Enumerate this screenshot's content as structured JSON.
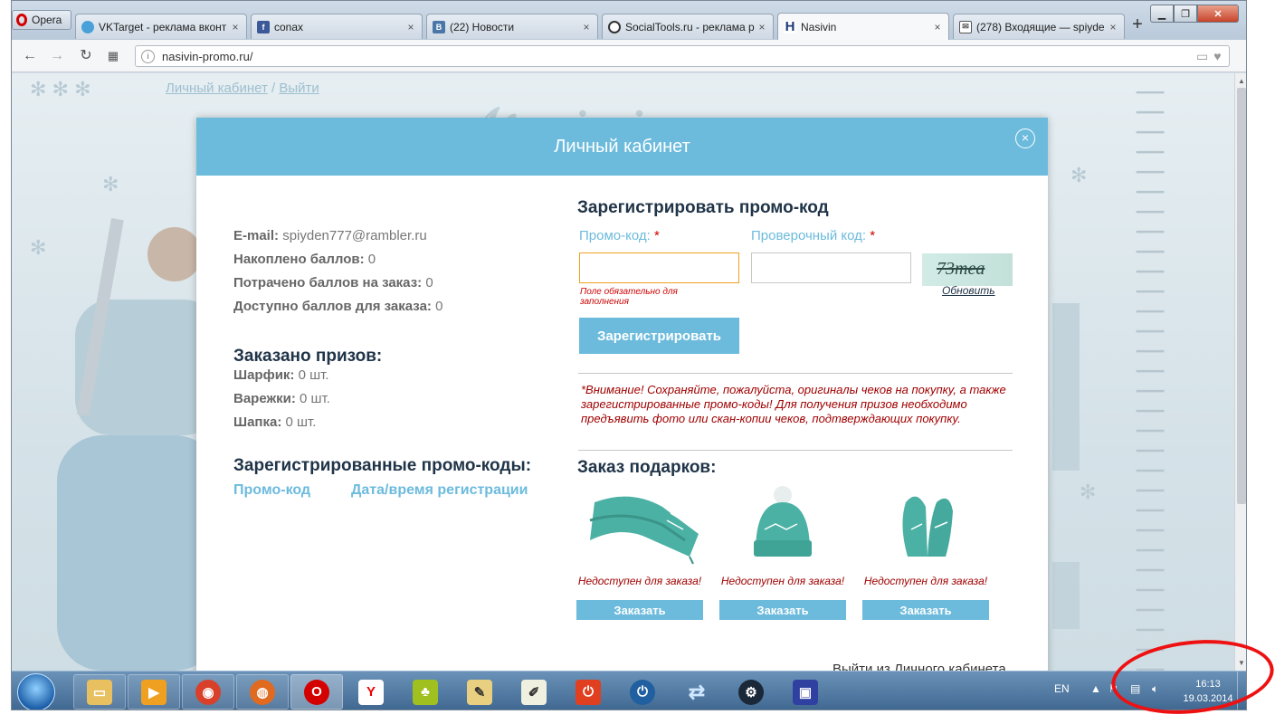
{
  "browser": {
    "opera_label": "Opera",
    "tabs": [
      {
        "label": "VKTarget - реклама вконт",
        "icon": "vktarget-icon",
        "color": "#4aa0d8"
      },
      {
        "label": "conax",
        "icon": "facebook-icon",
        "color": "#3b5998"
      },
      {
        "label": "(22) Новости",
        "icon": "vk-icon",
        "color": "#4a76a8"
      },
      {
        "label": "SocialTools.ru - реклама р",
        "icon": "socialtools-icon",
        "color": "#333333"
      },
      {
        "label": "Nasivin",
        "icon": "nasivin-icon",
        "color": "#1b3a78"
      },
      {
        "label": "(278) Входящие — spiyde",
        "icon": "mail-icon",
        "color": "#555555"
      }
    ],
    "active_tab": 4,
    "new_tab_label": "+",
    "url": "nasivin-promo.ru/"
  },
  "page": {
    "cabinet_link": "Личный кабинет",
    "separator": "/",
    "logout_link": "Выйти"
  },
  "modal": {
    "title": "Личный кабинет",
    "close": "×",
    "account": {
      "email_label": "E-mail:",
      "email_value": "spiyden777@rambler.ru",
      "earned_label": "Накоплено баллов:",
      "earned_value": "0",
      "spent_label": "Потрачено баллов на заказ:",
      "spent_value": "0",
      "available_label": "Доступно баллов для заказа:",
      "available_value": "0"
    },
    "ordered": {
      "heading": "Заказано призов:",
      "items": [
        {
          "label": "Шарфик:",
          "value": "0 шт."
        },
        {
          "label": "Варежки:",
          "value": "0 шт."
        },
        {
          "label": "Шапка:",
          "value": "0 шт."
        }
      ]
    },
    "registered": {
      "heading": "Зарегистрированные промо-коды:",
      "col_code": "Промо-код",
      "col_date": "Дата/время регистрации"
    },
    "register": {
      "heading": "Зарегистрировать промо-код",
      "promo_label": "Промо-код:",
      "check_label": "Проверочный код:",
      "required_mark": "*",
      "promo_value": "",
      "check_value": "",
      "error_line1": "Поле обязательно для",
      "error_line2": "заполнения",
      "captcha_text": "73mea",
      "refresh": "Обновить",
      "submit": "Зарегистрировать"
    },
    "notice": "*Внимание! Сохраняйте, пожалуйста, оригиналы чеков на покупку, а также зарегистрированные промо-коды! Для получения призов необходимо предъявить фото или скан-копии чеков, подтверждающих покупку.",
    "gifts": {
      "heading": "Заказ подарков:",
      "items": [
        {
          "icon": "scarf-icon",
          "unavailable": "Недоступен для заказа!",
          "button": "Заказать"
        },
        {
          "icon": "hat-icon",
          "unavailable": "Недоступен для заказа!",
          "button": "Заказать"
        },
        {
          "icon": "mittens-icon",
          "unavailable": "Недоступен для заказа!",
          "button": "Заказать"
        }
      ]
    },
    "logout_bottom": "Выйти из Личного кабинета"
  },
  "taskbar": {
    "language": "EN",
    "time": "16:13",
    "date": "19.03.2014"
  },
  "colors": {
    "accent": "#6cbbdd",
    "heading": "#203448",
    "warning": "#a00000",
    "annotation": "#ee1111"
  }
}
